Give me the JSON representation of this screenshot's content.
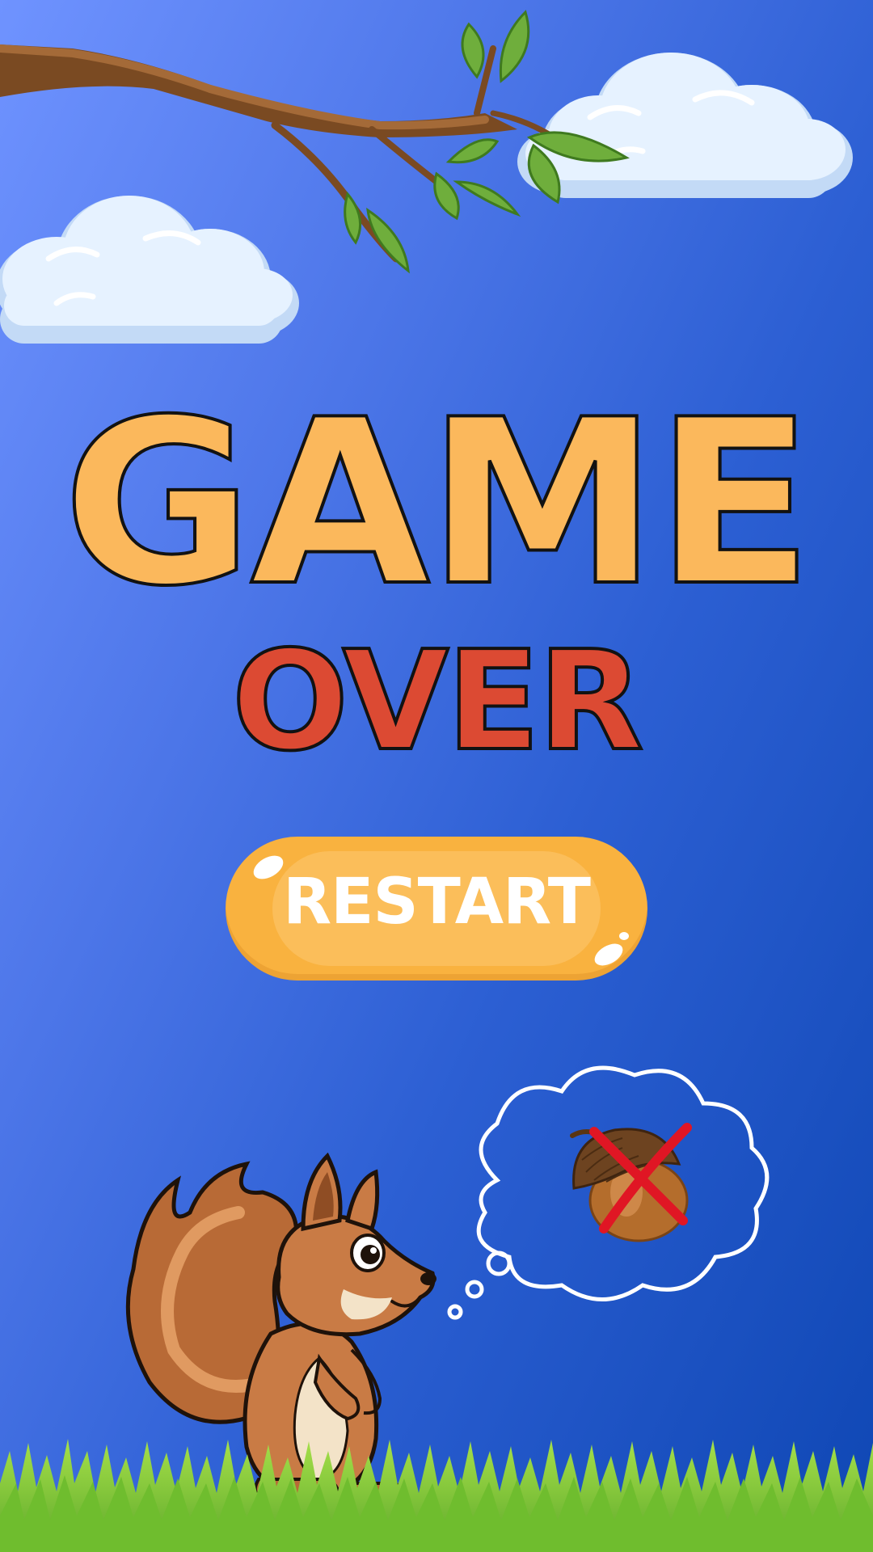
{
  "screen": "game-over",
  "title": {
    "line1": "GAME",
    "line2": "OVER"
  },
  "restart_button": {
    "label": "RESTART"
  },
  "thought_bubble": {
    "content": "acorn",
    "crossed_out": true
  },
  "colors": {
    "sky_light": "#6f93ff",
    "sky_dark": "#0f47b4",
    "title_game": "#fbb85c",
    "title_over": "#dc4a33",
    "button": "#f9b23f",
    "grass": "#7cc832"
  },
  "icons": [
    "branch-icon",
    "cloud-icon",
    "squirrel-icon",
    "thought-bubble-icon",
    "acorn-icon",
    "red-x-icon",
    "grass-icon"
  ]
}
